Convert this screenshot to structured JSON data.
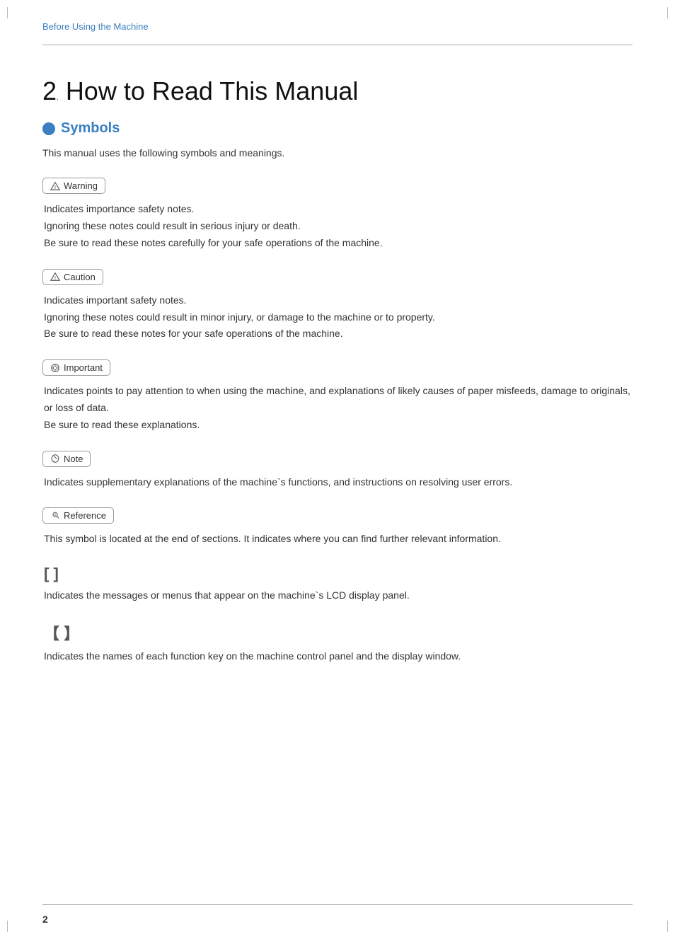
{
  "header": {
    "breadcrumb": "Before Using the Machine"
  },
  "chapter": {
    "number": "2",
    "title": "How to Read This Manual"
  },
  "section": {
    "title": "Symbols",
    "intro": "This manual uses the following symbols and meanings."
  },
  "symbols": [
    {
      "id": "warning",
      "label": "Warning",
      "icon": "triangle-warning",
      "lines": [
        "Indicates importance safety notes.",
        "Ignoring these notes could result in serious injury or death.",
        "Be sure to read these notes carefully for your safe operations of the machine."
      ]
    },
    {
      "id": "caution",
      "label": "Caution",
      "icon": "triangle-caution",
      "lines": [
        "Indicates important safety notes.",
        "Ignoring these notes could result in minor injury, or damage to the machine or to property.",
        " Be sure to read these notes for your safe operations of the machine."
      ]
    },
    {
      "id": "important",
      "label": "Important",
      "icon": "gear-important",
      "lines": [
        "Indicates points to pay attention to when using the machine, and explanations of likely causes of paper misfeeds, damage to originals, or loss of data.",
        "Be sure to read these explanations."
      ]
    },
    {
      "id": "note",
      "label": "Note",
      "icon": "pencil-note",
      "lines": [
        "Indicates supplementary explanations of the machine`s functions, and instructions on resolving user errors."
      ]
    },
    {
      "id": "reference",
      "label": "Reference",
      "icon": "key-reference",
      "lines": [
        "This symbol is located at the end of sections.  It indicates where you can find further relevant information."
      ]
    }
  ],
  "bracket_symbols": [
    {
      "id": "square-bracket",
      "symbol": "[    ]",
      "description": "Indicates the messages or menus that appear on the machine`s LCD display panel."
    },
    {
      "id": "bold-bracket",
      "symbol": "【   】",
      "description": "Indicates the names of each function key on the machine control panel and the display window."
    }
  ],
  "footer": {
    "page_number": "2"
  }
}
